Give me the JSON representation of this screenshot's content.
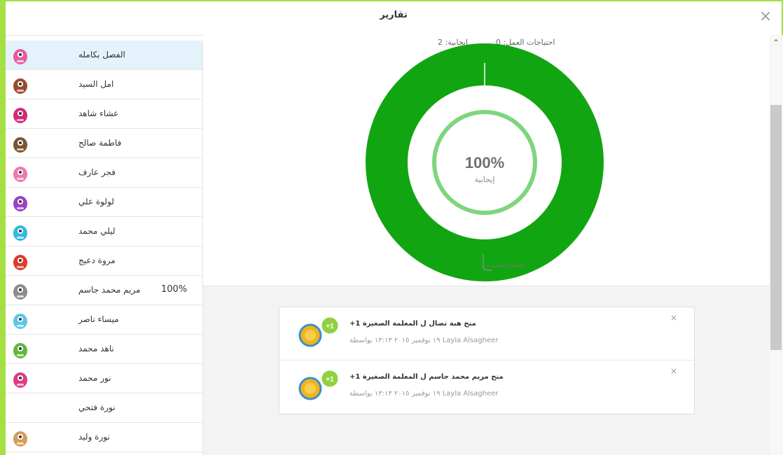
{
  "window": {
    "title": "تقارير",
    "close_label": "×"
  },
  "stats": {
    "positive": "إيجابية:  2",
    "needs_work": "احتياجات العمل:  0"
  },
  "donut": {
    "percent": "100%",
    "label": "إيجابية",
    "positive_fraction": 1.0,
    "legend": "___المعلمة الصغيرة"
  },
  "students": [
    {
      "name": "الفصل بكامله",
      "active": true,
      "percent": ""
    },
    {
      "name": "امل السيد",
      "percent": ""
    },
    {
      "name": "عشاء شاهد",
      "percent": ""
    },
    {
      "name": "فاطمة صالح",
      "percent": ""
    },
    {
      "name": "فجر عارف",
      "percent": ""
    },
    {
      "name": "لولوة علي",
      "percent": ""
    },
    {
      "name": "ليلي محمد",
      "percent": ""
    },
    {
      "name": "مروة دعيج",
      "percent": ""
    },
    {
      "name": "مريم محمد جاسم",
      "percent": "100%"
    },
    {
      "name": "ميساء ناصر",
      "percent": ""
    },
    {
      "name": "ناهد محمد",
      "percent": ""
    },
    {
      "name": "نور محمد",
      "percent": ""
    },
    {
      "name": "نورة فتحي",
      "percent": ""
    },
    {
      "name": "نورة وليد",
      "percent": ""
    }
  ],
  "awards": [
    {
      "title": "منح هبة تضال ل المعلمة الصغيرة 1+",
      "meta": "١٩ نوفمبر ٢٠١٥ ١٣:١٣ بواسطة Layla Alsagheer",
      "badge": "+1",
      "close": "×"
    },
    {
      "title": "منح مريم محمد جاسم ل المعلمة الصغيرة 1+",
      "meta": "١٩ نوفمبر ٢٠١٥ ١٣:١٣ بواسطة Layla Alsagheer",
      "badge": "+1",
      "close": "×"
    }
  ],
  "colors": {
    "accent": "#a4e043",
    "positive": "#12a512",
    "badge_green": "#8fd13f"
  }
}
